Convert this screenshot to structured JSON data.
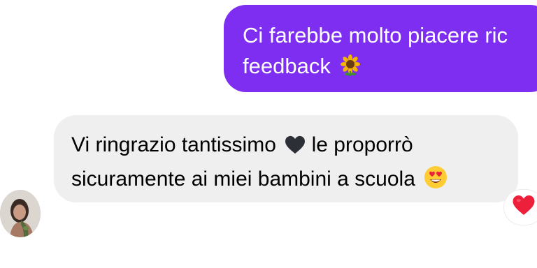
{
  "conversation": {
    "outgoing": {
      "line1": "Ci farebbe molto piacere ric",
      "line2": "feedback",
      "emoji": "sunflower-icon"
    },
    "incoming": {
      "line1a": "Vi ringrazio tantissimo",
      "line1_emoji": "black-heart-icon",
      "line1b": "le proporrò",
      "line2": "sicuramente ai miei bambini a scuola",
      "line2_emoji": "heart-eyes-icon"
    },
    "reaction": {
      "icon": "red-heart-icon",
      "color": "#ed1f3a"
    },
    "colors": {
      "outgoing_bubble": "#7d2ef0",
      "incoming_bubble": "#efefef"
    }
  }
}
